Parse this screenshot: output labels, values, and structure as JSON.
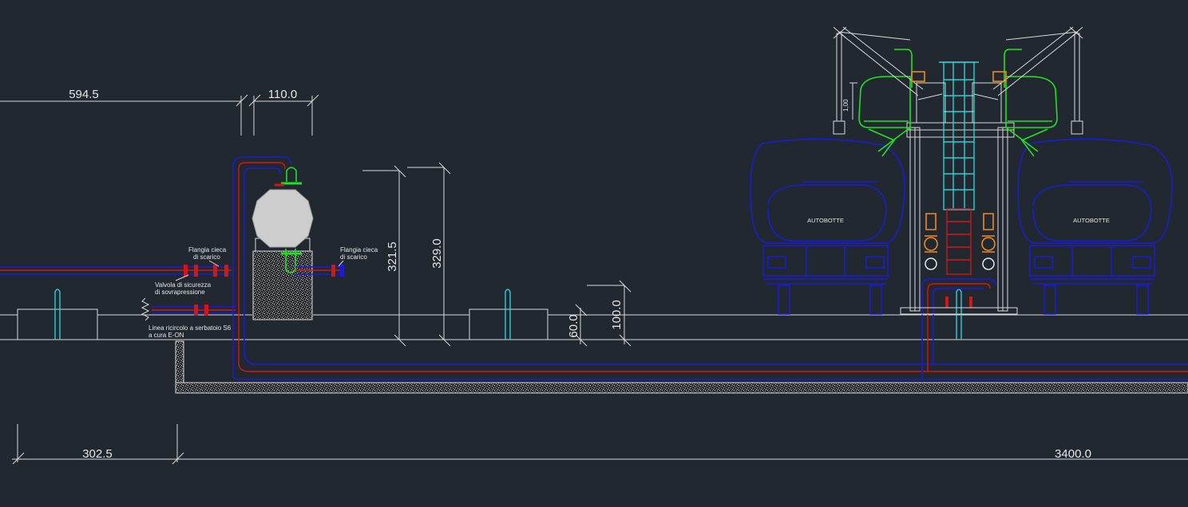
{
  "colors": {
    "background": "#212830",
    "dimension": "#d9d9d9",
    "pipe_outer": "#1c1cd0",
    "pipe_inner": "#d01818",
    "green_equipment": "#22e022",
    "cyan_equipment": "#2ad0d8",
    "orange_valves": "#f08a18",
    "concrete_fill": "#9a9a9a"
  },
  "dimensions": {
    "d594": "594.5",
    "d110": "110.0",
    "d321": "321.5",
    "d329": "329.0",
    "d60": "60.0",
    "d100": "100.0",
    "d302": "302.5",
    "d3400": "3400.0",
    "arm_small": "1,00"
  },
  "annotations": {
    "flangia_left_1": "Flangia cieca",
    "flangia_left_2": "di scarico",
    "flangia_right_1": "Flangia cieca",
    "flangia_right_2": "di scarico",
    "valvola_1": "Valvola di sicurezza",
    "valvola_2": "di sovrapressione",
    "linea_1": "Linea ricircolo a serbatoio S6",
    "linea_2": "a cura E-ON"
  },
  "trucks": {
    "left_label": "AUTOBOTTE",
    "right_label": "AUTOBOTTE"
  }
}
